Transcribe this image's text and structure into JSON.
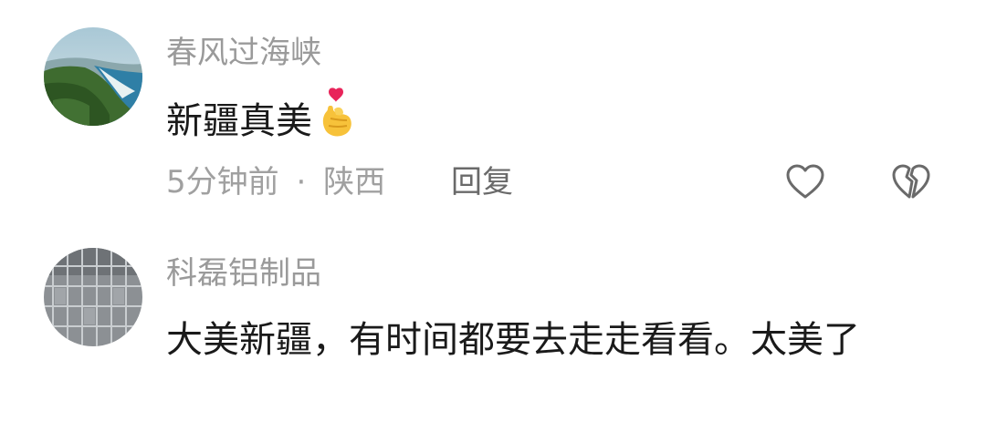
{
  "comments": [
    {
      "username": "春风过海峡",
      "text": "新疆真美",
      "emoji_icon": "finger-heart-emoji-icon",
      "time": "5分钟前",
      "separator": "·",
      "location": "陕西",
      "reply_label": "回复",
      "avatar_icon": "coastline-landscape-avatar"
    },
    {
      "username": "科磊铝制品",
      "text": "大美新疆，有时间都要去走走看看。太美了",
      "avatar_icon": "aluminum-shelving-avatar"
    }
  ],
  "icons": {
    "like": "heart-outline-icon",
    "dislike": "broken-heart-outline-icon"
  },
  "colors": {
    "username": "#9a9a9a",
    "text": "#1a1a1a",
    "meta": "#a0a0a0",
    "icon": "#6a6a6a"
  }
}
